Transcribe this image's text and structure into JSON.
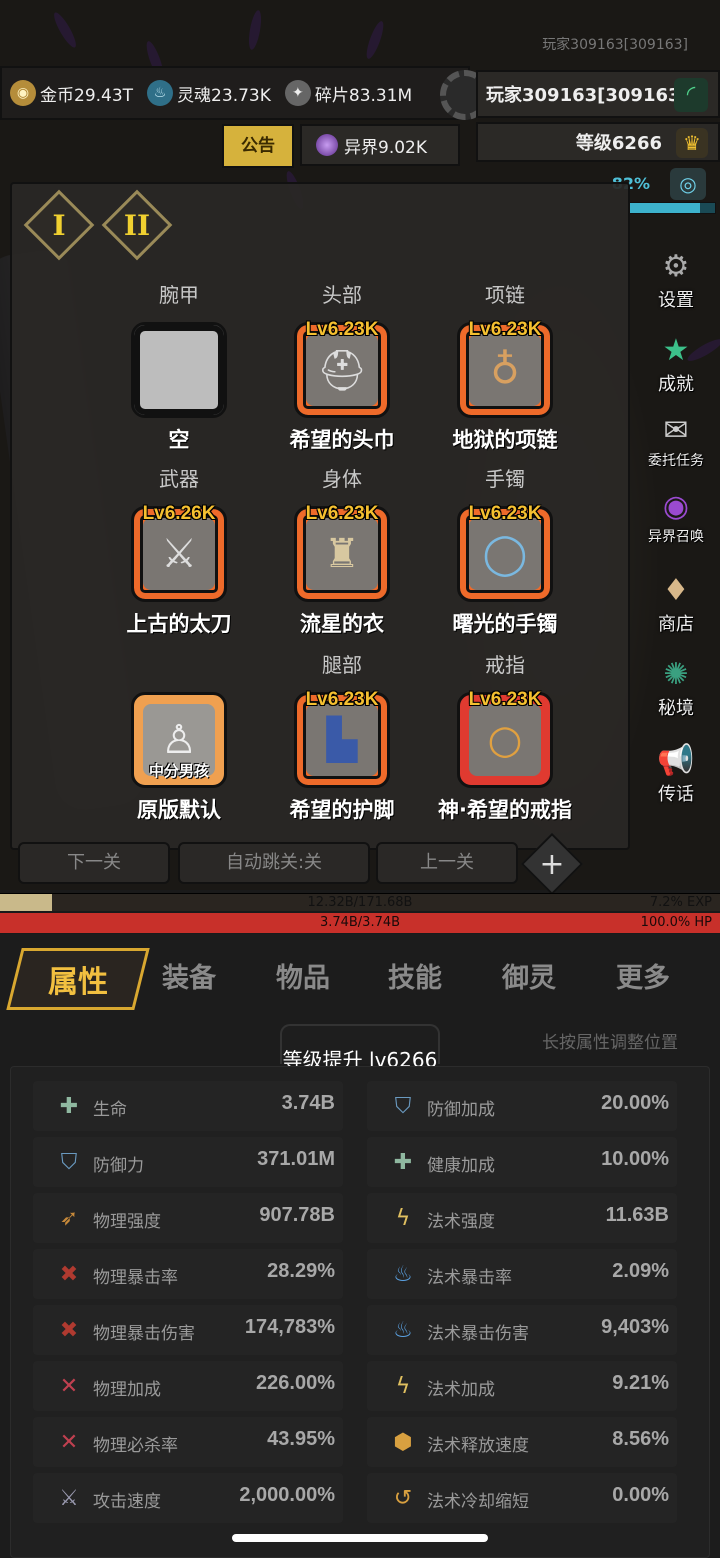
{
  "header": {
    "player_top": "玩家309163[309163]",
    "currencies": [
      {
        "icon": "gold-coin-icon",
        "label": "金币29.43T"
      },
      {
        "icon": "soul-icon",
        "label": "灵魂23.73K"
      },
      {
        "icon": "shard-icon",
        "label": "碎片83.31M"
      }
    ],
    "player_name": "玩家309163[309163]",
    "level": "等级6266",
    "notice": "公告",
    "otherworld": "异界9.02K",
    "progress_text": "82%",
    "progress_value": 0.82
  },
  "side_menu": [
    {
      "icon": "gear-icon",
      "label": "设置"
    },
    {
      "icon": "star-icon",
      "label": "成就"
    },
    {
      "icon": "scroll-icon",
      "label": "委托任务"
    },
    {
      "icon": "portal-icon",
      "label": "异界召唤"
    },
    {
      "icon": "shop-icon",
      "label": "商店"
    },
    {
      "icon": "realm-icon",
      "label": "秘境"
    },
    {
      "icon": "horn-icon",
      "label": "传话"
    }
  ],
  "equipment": {
    "tabs": [
      "I",
      "II"
    ],
    "slots": [
      {
        "category": "腕甲",
        "level": "",
        "item": "空",
        "style": "empty",
        "icon": "empty-slot-icon"
      },
      {
        "category": "头部",
        "level": "Lv6.23K",
        "item": "希望的头巾",
        "style": "orange",
        "icon": "helmet-icon"
      },
      {
        "category": "项链",
        "level": "Lv6.23K",
        "item": "地狱的项链",
        "style": "orange",
        "icon": "necklace-icon"
      },
      {
        "category": "武器",
        "level": "Lv6.26K",
        "item": "上古的太刀",
        "style": "orange",
        "icon": "katana-icon"
      },
      {
        "category": "身体",
        "level": "Lv6.23K",
        "item": "流星的衣",
        "style": "orange",
        "icon": "armor-icon"
      },
      {
        "category": "手镯",
        "level": "Lv6.23K",
        "item": "曙光的手镯",
        "style": "orange",
        "icon": "bracelet-icon"
      },
      {
        "category": "",
        "level": "",
        "item": "原版默认",
        "skin": "中分男孩",
        "style": "gold",
        "icon": "character-icon"
      },
      {
        "category": "腿部",
        "level": "Lv6.23K",
        "item": "希望的护脚",
        "style": "orange",
        "icon": "boot-icon"
      },
      {
        "category": "戒指",
        "level": "Lv6.23K",
        "item": "神·希望的戒指",
        "style": "red",
        "icon": "ring-icon"
      }
    ]
  },
  "stage_buttons": {
    "prev": "下一关",
    "auto": "自动跳关:关",
    "next": "上一关"
  },
  "bars": {
    "exp_text": "12.32B/171.68B",
    "exp_pct": "7.2% EXP",
    "exp_value": 0.072,
    "hp_text": "3.74B/3.74B",
    "hp_pct": "100.0%  HP",
    "hp_value": 1.0
  },
  "tabs": [
    "属性",
    "装备",
    "物品",
    "技能",
    "御灵",
    "更多"
  ],
  "hint": "长按属性调整位置",
  "level_up": "等级提升 lv6266",
  "stats_left": [
    {
      "icon": "health-cross-icon",
      "name": "生命",
      "value": "3.74B"
    },
    {
      "icon": "shield-icon",
      "name": "防御力",
      "value": "371.01M"
    },
    {
      "icon": "physical-strength-icon",
      "name": "物理强度",
      "value": "907.78B"
    },
    {
      "icon": "physical-crit-icon",
      "name": "物理暴击率",
      "value": "28.29%"
    },
    {
      "icon": "physical-crit-damage-icon",
      "name": "物理暴击伤害",
      "value": "174,783%"
    },
    {
      "icon": "physical-bonus-icon",
      "name": "物理加成",
      "value": "226.00%"
    },
    {
      "icon": "execute-icon",
      "name": "物理必杀率",
      "value": "43.95%"
    },
    {
      "icon": "attack-speed-icon",
      "name": "攻击速度",
      "value": "2,000.00%"
    }
  ],
  "stats_right": [
    {
      "icon": "defense-bonus-icon",
      "name": "防御加成",
      "value": "20.00%"
    },
    {
      "icon": "health-bonus-icon",
      "name": "健康加成",
      "value": "10.00%"
    },
    {
      "icon": "spell-strength-icon",
      "name": "法术强度",
      "value": "11.63B"
    },
    {
      "icon": "spell-crit-icon",
      "name": "法术暴击率",
      "value": "2.09%"
    },
    {
      "icon": "spell-crit-damage-icon",
      "name": "法术暴击伤害",
      "value": "9,403%"
    },
    {
      "icon": "spell-bonus-icon",
      "name": "法术加成",
      "value": "9.21%"
    },
    {
      "icon": "cast-speed-icon",
      "name": "法术释放速度",
      "value": "8.56%"
    },
    {
      "icon": "cooldown-icon",
      "name": "法术冷却缩短",
      "value": "0.00%"
    }
  ],
  "colors": {
    "accent_gold": "#f2c040",
    "item_orange": "#ee6a2a",
    "item_red": "#e03a30",
    "hp_red": "#c8302a",
    "exp_tan": "#c9b98a"
  }
}
